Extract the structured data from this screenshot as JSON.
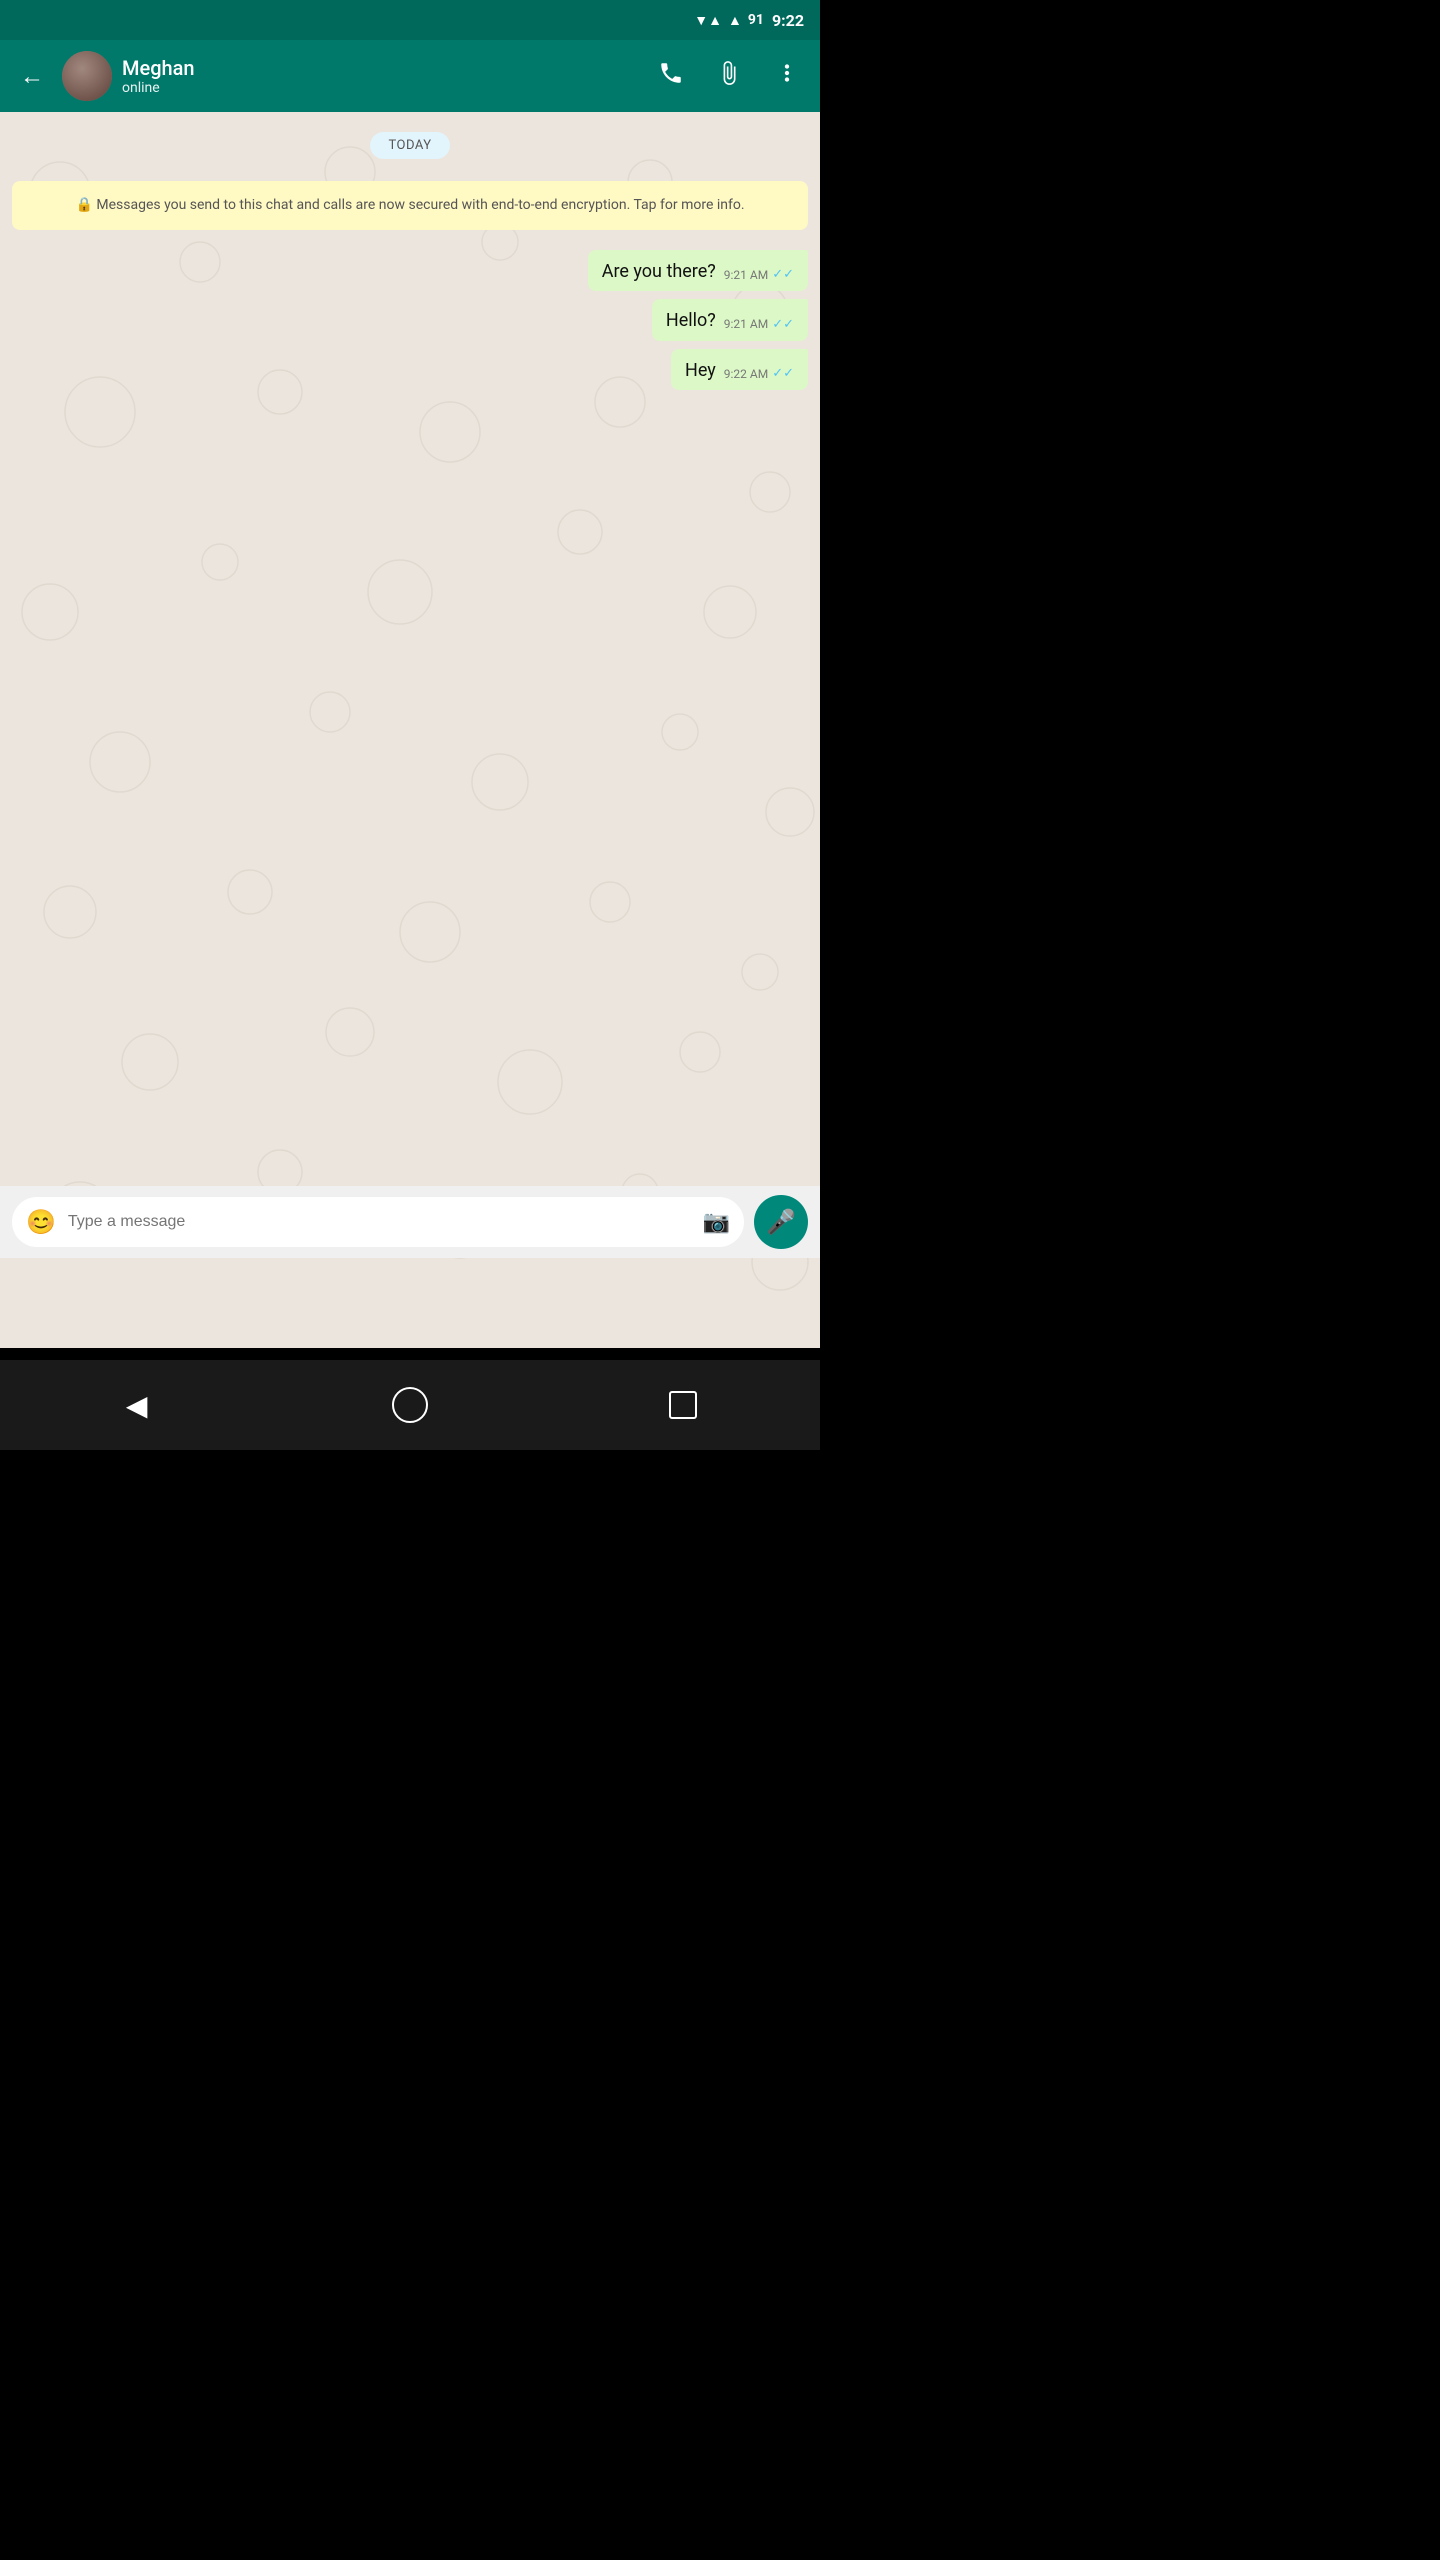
{
  "statusBar": {
    "time": "9:22",
    "battery": "91"
  },
  "header": {
    "contactName": "Meghan",
    "contactStatus": "online",
    "backLabel": "←",
    "callIcon": "📞",
    "attachIcon": "📎",
    "menuIcon": "⋮"
  },
  "chat": {
    "dateBadge": "TODAY",
    "encryptionNotice": "🔒 Messages you send to this chat and calls are now secured with end-to-end encryption. Tap for more info.",
    "messages": [
      {
        "id": "msg1",
        "text": "Are you there?",
        "time": "9:21 AM",
        "ticks": "✓✓",
        "type": "sent"
      },
      {
        "id": "msg2",
        "text": "Hello?",
        "time": "9:21 AM",
        "ticks": "✓✓",
        "type": "sent"
      },
      {
        "id": "msg3",
        "text": "Hey",
        "time": "9:22 AM",
        "ticks": "✓✓",
        "type": "sent"
      }
    ]
  },
  "inputArea": {
    "placeholder": "Type a message",
    "emojiIcon": "😊",
    "cameraIcon": "📷",
    "micIcon": "🎤"
  },
  "navBar": {
    "backIcon": "◀",
    "homeIcon": "",
    "squareIcon": ""
  }
}
